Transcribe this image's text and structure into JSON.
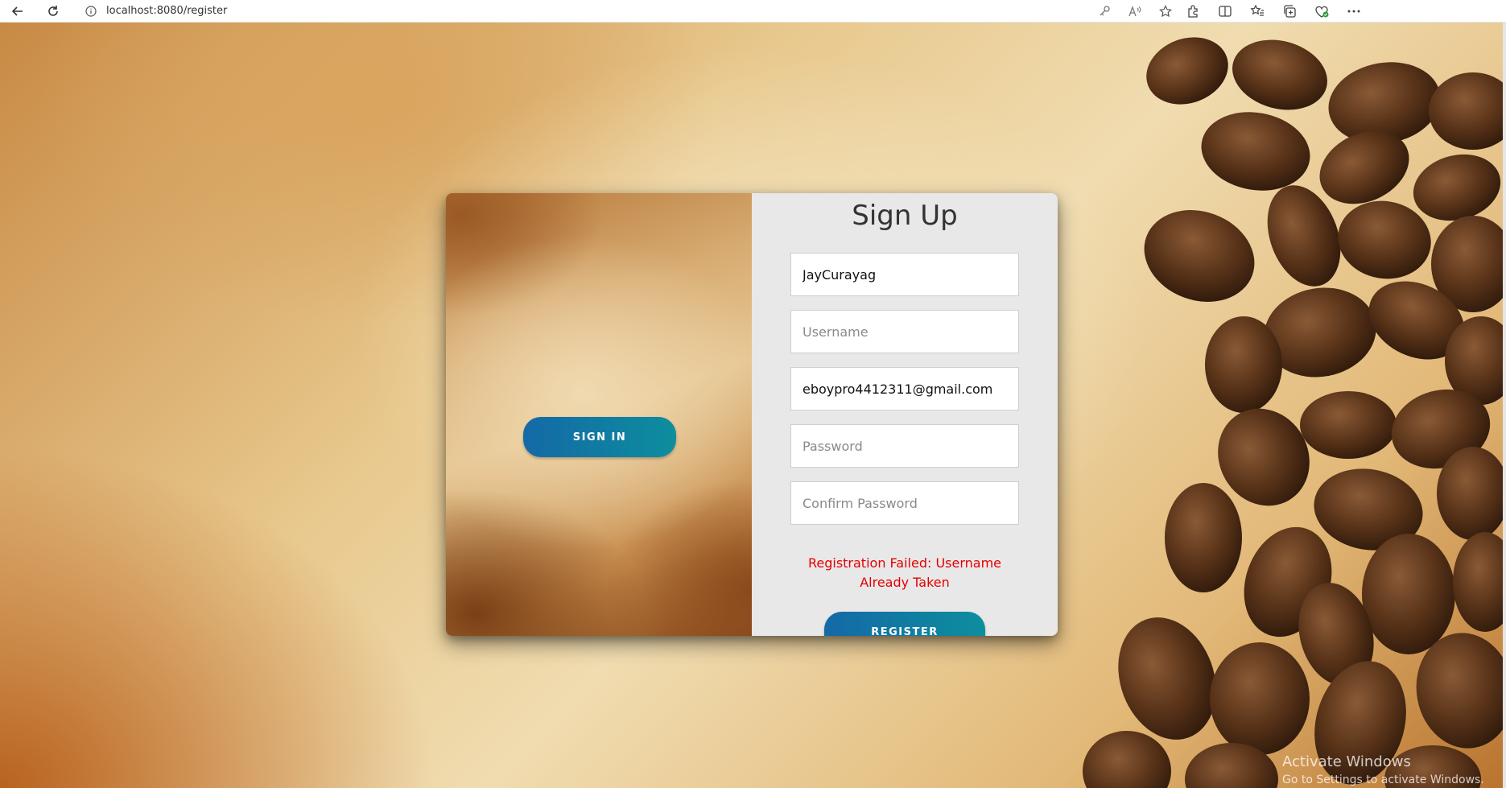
{
  "browser": {
    "url": "localhost:8080/register"
  },
  "form": {
    "title": "Sign Up",
    "name_value": "JayCurayag",
    "name_placeholder": "",
    "username_value": "",
    "username_placeholder": "Username",
    "email_value": "eboypro4412311@gmail.com",
    "email_placeholder": "",
    "password_value": "",
    "password_placeholder": "Password",
    "confirm_value": "",
    "confirm_placeholder": "Confirm Password",
    "error_message": "Registration Failed: Username Already Taken",
    "register_label": "REGISTER"
  },
  "side": {
    "signin_label": "SIGN IN"
  },
  "watermark": {
    "line1": "Activate Windows",
    "line2": "Go to Settings to activate Windows."
  },
  "colors": {
    "button_start": "#1469a6",
    "button_end": "#0d8e9e",
    "error": "#e60000",
    "panel": "#e8e8e8"
  }
}
